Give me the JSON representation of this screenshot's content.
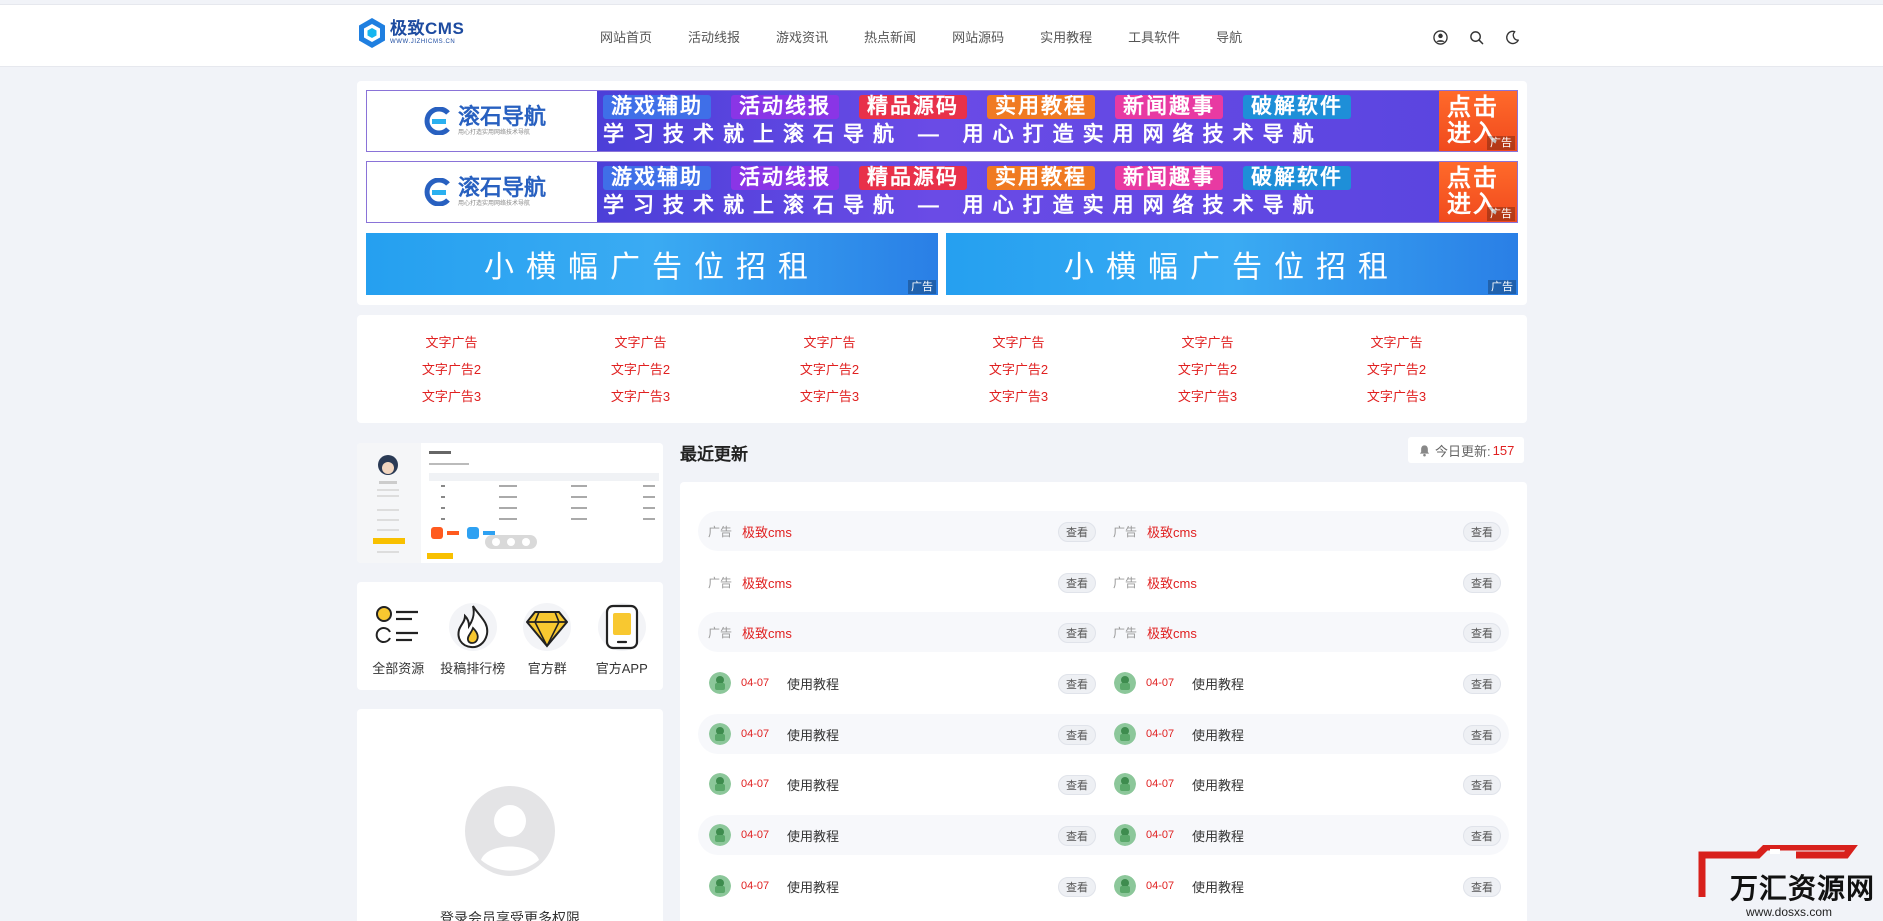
{
  "header": {
    "logo_title": "极致CMS",
    "logo_sub": "WWW.JIZHICMS.CN",
    "nav": [
      "网站首页",
      "活动线报",
      "游戏资讯",
      "热点新闻",
      "网站源码",
      "实用教程",
      "工具软件",
      "导航"
    ]
  },
  "banners": {
    "brand": "滚石导航",
    "brand_sub": "用心打造实用网络技术导航",
    "chips": [
      "游戏辅助",
      "活动线报",
      "精品源码",
      "实用教程",
      "新闻趣事",
      "破解软件"
    ],
    "chip_colors": [
      "#3f6fe8",
      "#8a35e6",
      "#e8314a",
      "#f07a22",
      "#e83aa2",
      "#1e8fd8"
    ],
    "tagline": "学习技术就上滚石导航 — 用心打造实用网络技术导航",
    "cta": "点击进入",
    "ad_badge": "广告",
    "small_text": "小横幅广告位招租"
  },
  "text_ads": {
    "columns": [
      [
        "文字广告",
        "文字广告2",
        "文字广告3"
      ],
      [
        "文字广告",
        "文字广告2",
        "文字广告3"
      ],
      [
        "文字广告",
        "文字广告2",
        "文字广告3"
      ],
      [
        "文字广告",
        "文字广告2",
        "文字广告3"
      ],
      [
        "文字广告",
        "文字广告2",
        "文字广告3"
      ],
      [
        "文字广告",
        "文字广告2",
        "文字广告3"
      ]
    ]
  },
  "shortcuts": [
    "全部资源",
    "投稿排行榜",
    "官方群",
    "官方APP"
  ],
  "login": {
    "text": "登录会员享受更多权限"
  },
  "recent": {
    "title": "最近更新",
    "today_label": "今日更新:",
    "today_count": "157",
    "view_label": "查看",
    "ad_rows": [
      [
        {
          "tag": "广告",
          "title": "极致cms"
        },
        {
          "tag": "广告",
          "title": "极致cms"
        }
      ],
      [
        {
          "tag": "广告",
          "title": "极致cms"
        },
        {
          "tag": "广告",
          "title": "极致cms"
        }
      ],
      [
        {
          "tag": "广告",
          "title": "极致cms"
        },
        {
          "tag": "广告",
          "title": "极致cms"
        }
      ]
    ],
    "post_rows": [
      [
        {
          "date": "04-07",
          "title": "使用教程"
        },
        {
          "date": "04-07",
          "title": "使用教程"
        }
      ],
      [
        {
          "date": "04-07",
          "title": "使用教程"
        },
        {
          "date": "04-07",
          "title": "使用教程"
        }
      ],
      [
        {
          "date": "04-07",
          "title": "使用教程"
        },
        {
          "date": "04-07",
          "title": "使用教程"
        }
      ],
      [
        {
          "date": "04-07",
          "title": "使用教程"
        },
        {
          "date": "04-07",
          "title": "使用教程"
        }
      ],
      [
        {
          "date": "04-07",
          "title": "使用教程"
        },
        {
          "date": "04-07",
          "title": "使用教程"
        }
      ]
    ]
  },
  "watermark": {
    "text": "万汇资源网",
    "url": "www.dosxs.com"
  },
  "colors": {
    "accent_red": "#e02020",
    "brand_blue": "#1d4ba0",
    "page_bg": "#f1f3f8"
  }
}
